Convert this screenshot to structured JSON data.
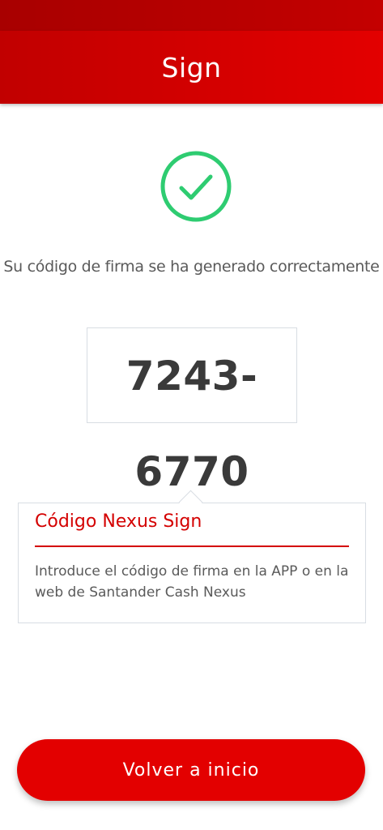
{
  "header": {
    "title": "Sign"
  },
  "status": {
    "icon": "check-circle-icon",
    "message": "Su código de firma se ha generado correctamente",
    "color": "#2ecc71"
  },
  "signature_code": {
    "value": "7243-6770"
  },
  "info_card": {
    "title": "Código Nexus Sign",
    "description": "Introduce el código de firma en la APP o en la web de Santander Cash Nexus"
  },
  "actions": {
    "back_label": "Volver a inicio"
  },
  "colors": {
    "brand_red": "#e30000",
    "dark_red": "#a80000",
    "success_green": "#2ecc71"
  }
}
